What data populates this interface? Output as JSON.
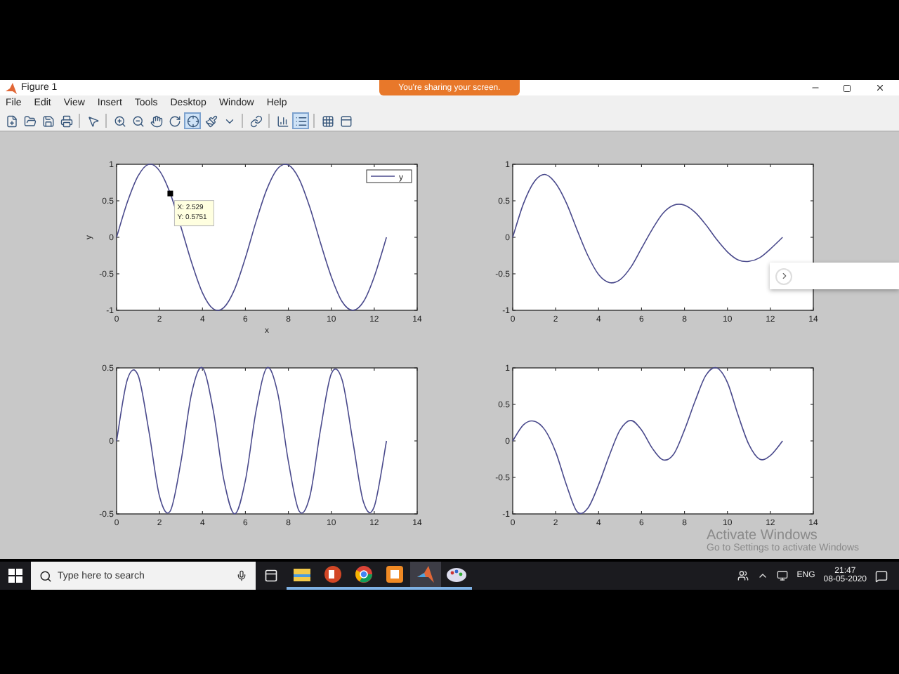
{
  "window": {
    "title": "Figure 1"
  },
  "share_banner": "You're sharing your screen.",
  "menu": [
    "File",
    "Edit",
    "View",
    "Insert",
    "Tools",
    "Desktop",
    "Window",
    "Help"
  ],
  "toolbar": [
    {
      "kind": "new",
      "selected": false
    },
    {
      "kind": "open",
      "selected": false
    },
    {
      "kind": "save",
      "selected": false
    },
    {
      "kind": "print",
      "selected": false
    },
    {
      "kind": "sep"
    },
    {
      "kind": "pointer",
      "selected": false
    },
    {
      "kind": "sep"
    },
    {
      "kind": "zoom-in",
      "selected": false
    },
    {
      "kind": "zoom-out",
      "selected": false
    },
    {
      "kind": "pan",
      "selected": false
    },
    {
      "kind": "rotate",
      "selected": false
    },
    {
      "kind": "cursor",
      "selected": true
    },
    {
      "kind": "brush",
      "selected": false
    },
    {
      "kind": "caret",
      "selected": false
    },
    {
      "kind": "sep"
    },
    {
      "kind": "link",
      "selected": false
    },
    {
      "kind": "sep"
    },
    {
      "kind": "colorbar",
      "selected": false
    },
    {
      "kind": "legend",
      "selected": true
    },
    {
      "kind": "sep"
    },
    {
      "kind": "grid",
      "selected": false
    },
    {
      "kind": "panel",
      "selected": false
    }
  ],
  "plots": [
    {
      "chart_data": {
        "type": "line",
        "xlabel": "x",
        "ylabel": "y",
        "legend": true,
        "xlim": [
          0,
          14
        ],
        "ylim": [
          -1,
          1
        ],
        "xticks": [
          0,
          2,
          4,
          6,
          8,
          10,
          12,
          14
        ],
        "yticks": [
          -1,
          -0.5,
          0,
          0.5,
          1
        ],
        "x": [
          0,
          0.5,
          1,
          1.5,
          2,
          2.5,
          3,
          3.5,
          4,
          4.5,
          5,
          5.5,
          6,
          6.5,
          7,
          7.5,
          8,
          8.5,
          9,
          9.5,
          10,
          10.5,
          11,
          11.5,
          12,
          12.57
        ],
        "series": [
          {
            "name": "y",
            "color": "#4a4a8c",
            "values": [
              0,
              0.48,
              0.84,
              1.0,
              0.91,
              0.6,
              0.14,
              -0.35,
              -0.76,
              -0.98,
              -0.96,
              -0.71,
              -0.28,
              0.22,
              0.66,
              0.94,
              0.99,
              0.8,
              0.41,
              -0.08,
              -0.54,
              -0.88,
              -1.0,
              -0.88,
              -0.54,
              0
            ]
          }
        ],
        "annotations": [
          {
            "text": "X: 2.529"
          },
          {
            "text": "Y: 0.5751"
          }
        ]
      }
    },
    {
      "chart_data": {
        "type": "line",
        "xlim": [
          0,
          14
        ],
        "ylim": [
          -1,
          1
        ],
        "xticks": [
          0,
          2,
          4,
          6,
          8,
          10,
          12,
          14
        ],
        "yticks": [
          -1,
          -0.5,
          0,
          0.5,
          1
        ],
        "x": [
          0,
          0.5,
          1,
          1.5,
          2,
          2.5,
          3,
          3.5,
          4,
          4.5,
          5,
          5.5,
          6,
          6.5,
          7,
          7.5,
          8,
          8.5,
          9,
          9.5,
          10,
          10.5,
          11,
          11.5,
          12,
          12.57
        ],
        "series": [
          {
            "color": "#4a4a8c",
            "values": [
              0,
              0.46,
              0.76,
              0.86,
              0.74,
              0.47,
              0.1,
              -0.25,
              -0.51,
              -0.62,
              -0.58,
              -0.41,
              -0.15,
              0.11,
              0.33,
              0.44,
              0.44,
              0.34,
              0.17,
              -0.03,
              -0.2,
              -0.31,
              -0.33,
              -0.28,
              -0.16,
              0
            ]
          }
        ]
      }
    },
    {
      "chart_data": {
        "type": "line",
        "xlim": [
          0,
          14
        ],
        "ylim": [
          -0.5,
          0.5
        ],
        "xticks": [
          0,
          2,
          4,
          6,
          8,
          10,
          12,
          14
        ],
        "yticks": [
          -0.5,
          0,
          0.5
        ],
        "x": [
          0,
          0.5,
          1,
          1.5,
          2,
          2.5,
          3,
          3.5,
          4,
          4.5,
          5,
          5.5,
          6,
          6.5,
          7,
          7.5,
          8,
          8.5,
          9,
          9.5,
          10,
          10.5,
          11,
          11.5,
          12,
          12.57
        ],
        "series": [
          {
            "color": "#4a4a8c",
            "values": [
              0,
              0.42,
              0.45,
              0.07,
              -0.38,
              -0.48,
              -0.14,
              0.33,
              0.5,
              0.21,
              -0.27,
              -0.5,
              -0.27,
              0.21,
              0.5,
              0.33,
              -0.14,
              -0.48,
              -0.38,
              0.08,
              0.46,
              0.42,
              0,
              -0.42,
              -0.45,
              0
            ]
          }
        ]
      }
    },
    {
      "chart_data": {
        "type": "line",
        "xlim": [
          0,
          14
        ],
        "ylim": [
          -1,
          1
        ],
        "xticks": [
          0,
          2,
          4,
          6,
          8,
          10,
          12,
          14
        ],
        "yticks": [
          -1,
          -0.5,
          0,
          0.5,
          1
        ],
        "x": [
          0,
          0.5,
          1,
          1.5,
          2,
          2.5,
          3,
          3.5,
          4,
          4.5,
          5,
          5.5,
          6,
          6.5,
          7,
          7.5,
          8,
          8.5,
          9,
          9.5,
          10,
          10.5,
          11,
          11.5,
          12,
          12.57
        ],
        "series": [
          {
            "color": "#4a4a8c",
            "values": [
              0,
              0.22,
              0.27,
              0.15,
              -0.15,
              -0.6,
              -0.97,
              -0.92,
              -0.6,
              -0.2,
              0.15,
              0.28,
              0.15,
              -0.1,
              -0.26,
              -0.18,
              0.15,
              0.55,
              0.9,
              1.0,
              0.8,
              0.35,
              -0.05,
              -0.25,
              -0.2,
              0
            ]
          }
        ]
      }
    }
  ],
  "activation_notice": {
    "title": "Activate Windows",
    "subtitle": "Go to Settings to activate Windows"
  },
  "taskbar": {
    "search": {
      "placeholder": "Type here to search"
    },
    "apps": [
      {
        "kind": "folder",
        "selected": false
      },
      {
        "kind": "slides",
        "selected": false
      },
      {
        "kind": "browser",
        "selected": false
      },
      {
        "kind": "orange",
        "selected": false
      },
      {
        "kind": "matlab",
        "selected": true
      },
      {
        "kind": "paint",
        "selected": false
      }
    ],
    "language": "ENG",
    "time": "21:47",
    "date": "08-05-2020"
  }
}
